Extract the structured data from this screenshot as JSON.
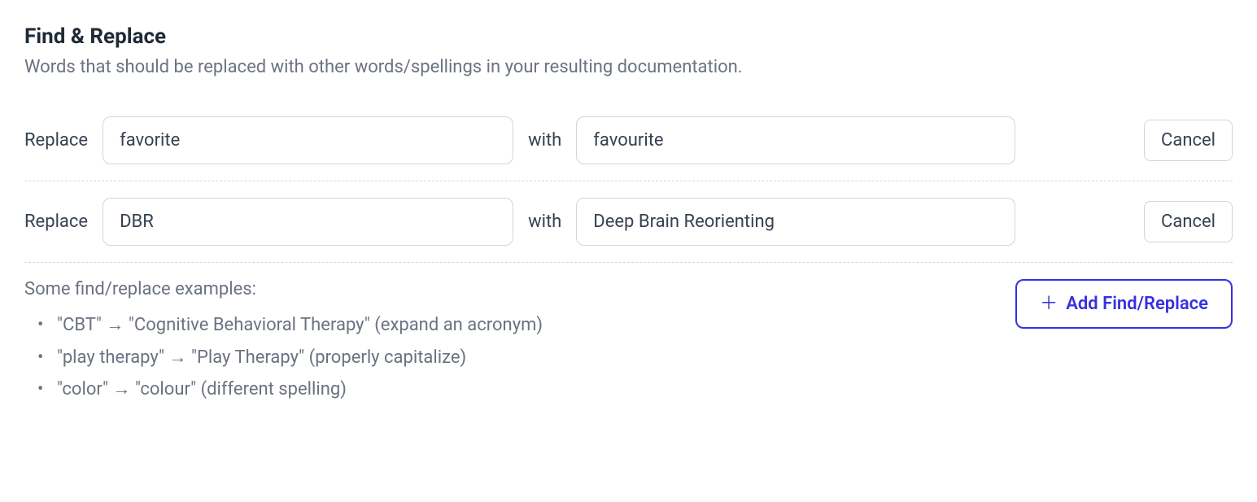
{
  "header": {
    "title": "Find & Replace",
    "subtitle": "Words that should be replaced with other words/spellings in your resulting documentation."
  },
  "labels": {
    "replace": "Replace",
    "with": "with",
    "cancel": "Cancel"
  },
  "rows": [
    {
      "find": "favorite",
      "replace": "favourite"
    },
    {
      "find": "DBR",
      "replace": "Deep Brain Reorienting"
    }
  ],
  "examples": {
    "title": "Some find/replace examples:",
    "items": [
      "\"CBT\" → \"Cognitive Behavioral Therapy\" (expand an acronym)",
      "\"play therapy\" → \"Play Therapy\" (properly capitalize)",
      "\"color\" → \"colour\" (different spelling)"
    ]
  },
  "addButton": {
    "label": "Add Find/Replace"
  }
}
